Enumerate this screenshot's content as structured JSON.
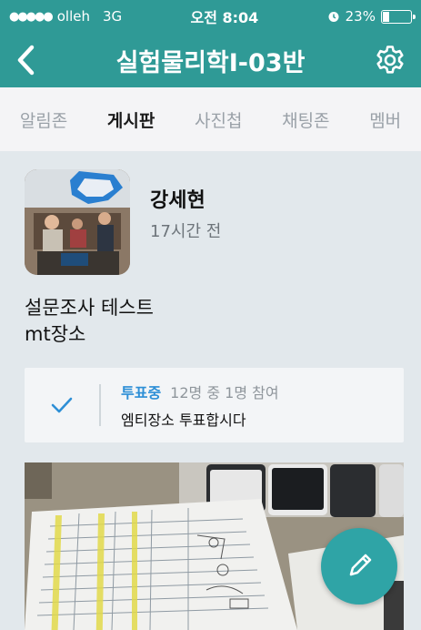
{
  "status_bar": {
    "carrier": "olleh",
    "network": "3G",
    "time": "오전 8:04",
    "battery": "23%",
    "battery_level": 0.23
  },
  "nav": {
    "title": "실험물리학I-03반",
    "back_icon": "chevron-left-icon",
    "settings_icon": "gear-icon"
  },
  "tabs": [
    {
      "label": "알림존",
      "active": false
    },
    {
      "label": "게시판",
      "active": true
    },
    {
      "label": "사진첩",
      "active": false
    },
    {
      "label": "채팅존",
      "active": false
    },
    {
      "label": "멤버",
      "active": false
    }
  ],
  "post": {
    "author": "강세현",
    "time": "17시간 전",
    "body_line1": "설문조사 테스트",
    "body_line2": "mt장소",
    "poll": {
      "status": "투표중",
      "participation": "12명 중 1명 참여",
      "title": "엠티장소 투표합시다",
      "check_icon": "checkmark-icon"
    }
  },
  "fab": {
    "icon": "pencil-icon"
  },
  "colors": {
    "brand": "#2f9a96",
    "poll_status": "#2d8fd6",
    "fab": "#2fa4a6"
  }
}
